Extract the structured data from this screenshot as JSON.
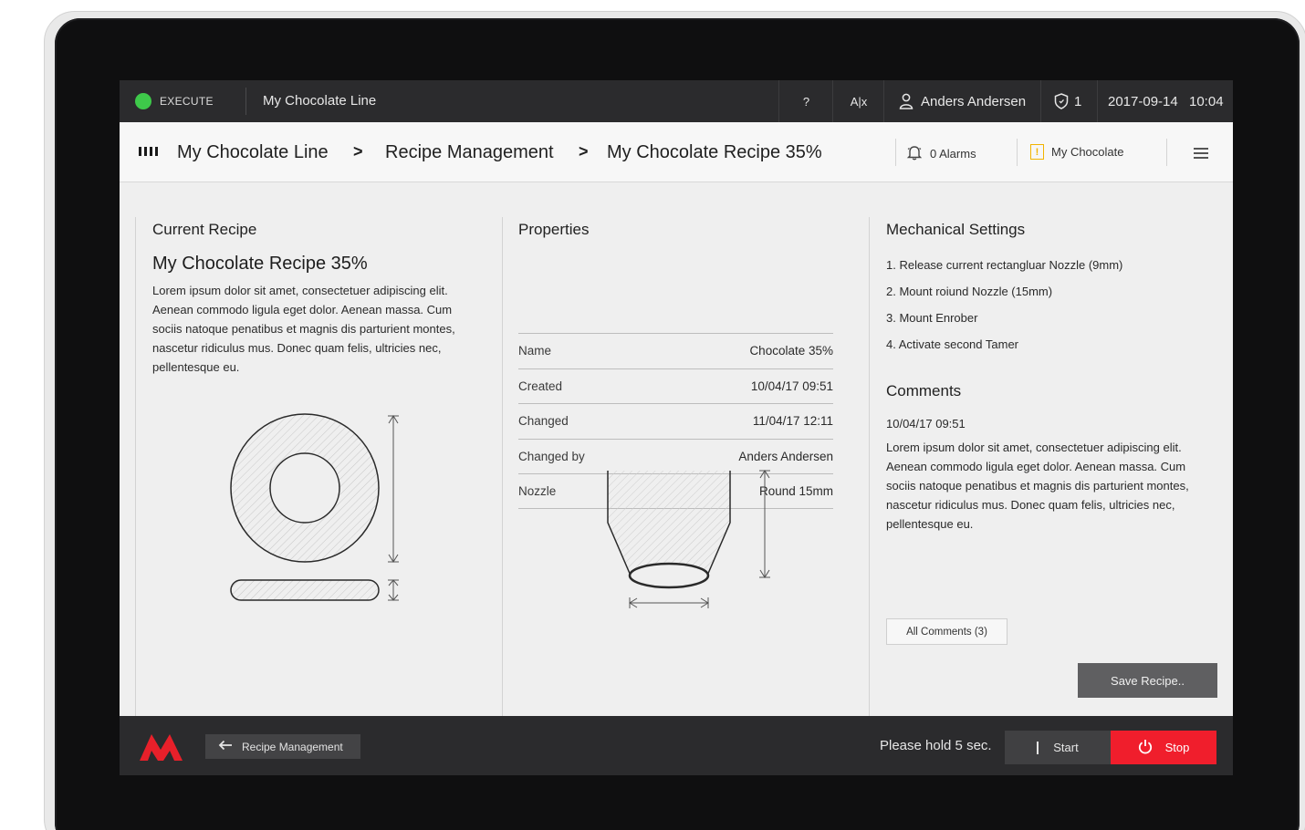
{
  "statusbar": {
    "state": "EXECUTE",
    "state_color": "#3ec94a",
    "line_name": "My Chocolate Line",
    "help": "?",
    "language": "A|x",
    "user_icon": "user-icon",
    "user": "Anders Andersen",
    "shield_icon": "shield-icon",
    "shield_count": "1",
    "date": "2017-09-14",
    "time": "10:04"
  },
  "header": {
    "breadcrumb": [
      "My Chocolate Line",
      "Recipe Management",
      "My Chocolate Recipe 35%"
    ],
    "separator": ">",
    "alarms": "0 Alarms",
    "alarm_icon": "bell-icon",
    "warning_label": "My Chocolate",
    "warning_symbol": "!",
    "warning_color": "#f2b400",
    "menu_icon": "hamburger-icon"
  },
  "current_recipe": {
    "title": "Current Recipe",
    "name": "My Chocolate Recipe 35%",
    "description": "Lorem ipsum dolor sit amet, consectetuer adipiscing elit. Aenean commodo ligula eget dolor. Aenean massa. Cum sociis natoque penatibus et magnis dis parturient montes, nascetur ridiculus mus. Donec quam felis, ultricies nec, pellentesque eu."
  },
  "properties": {
    "title": "Properties",
    "rows": [
      {
        "label": "Name",
        "value": "Chocolate 35%"
      },
      {
        "label": "Created",
        "value": "10/04/17 09:51"
      },
      {
        "label": "Changed",
        "value": "11/04/17 12:11"
      },
      {
        "label": "Changed by",
        "value": "Anders Andersen"
      },
      {
        "label": "Nozzle",
        "value": "Round 15mm"
      }
    ]
  },
  "mechanical": {
    "title": "Mechanical Settings",
    "steps": [
      "1. Release current rectangluar Nozzle (9mm)",
      "2. Mount roiund Nozzle (15mm)",
      "3. Mount Enrober",
      "4. Activate second Tamer"
    ]
  },
  "comments": {
    "title": "Comments",
    "date": "10/04/17 09:51",
    "text": "Lorem ipsum dolor sit amet, consectetuer adipiscing elit. Aenean commodo ligula eget dolor. Aenean massa. Cum sociis natoque penatibus et magnis dis parturient montes, nascetur ridiculus mus. Donec quam felis, ultricies nec, pellentesque eu.",
    "all_button": "All Comments (3)"
  },
  "actions": {
    "save": "Save Recipe.."
  },
  "bottombar": {
    "logo_color": "#e8202a",
    "back_label": "Recipe Management",
    "hold_text": "Please hold 5 sec.",
    "start_label": "Start",
    "stop_label": "Stop",
    "stop_color": "#f01e2c"
  }
}
